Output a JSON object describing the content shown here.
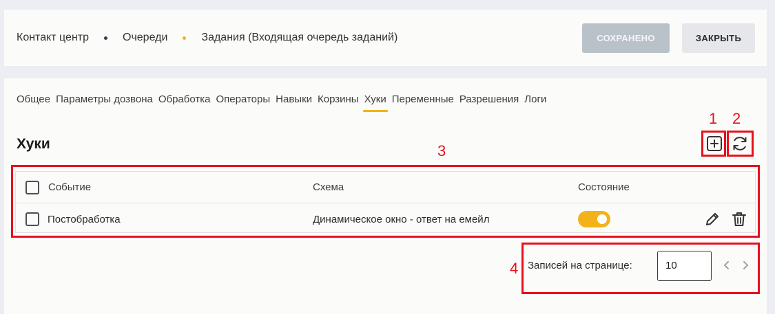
{
  "breadcrumb": {
    "items": [
      "Контакт центр",
      "Очереди",
      "Задания (Входящая очередь заданий)"
    ],
    "dot_colors": [
      "#2d3e50",
      "#f3b21a"
    ]
  },
  "toolbar": {
    "saved_label": "СОХРАНЕНО",
    "close_label": "ЗАКРЫТЬ"
  },
  "tabs": [
    {
      "label": "Общее"
    },
    {
      "label": "Параметры дозвона"
    },
    {
      "label": "Обработка"
    },
    {
      "label": "Операторы"
    },
    {
      "label": "Навыки"
    },
    {
      "label": "Корзины"
    },
    {
      "label": "Хуки",
      "active": true
    },
    {
      "label": "Переменные"
    },
    {
      "label": "Разрешения"
    },
    {
      "label": "Логи"
    }
  ],
  "section": {
    "title": "Хуки",
    "add_icon": "plus-square-icon",
    "refresh_icon": "refresh-icon"
  },
  "table": {
    "columns": [
      "Событие",
      "Схема",
      "Состояние"
    ],
    "rows": [
      {
        "event": "Постобработка",
        "scheme": "Динамическое окно - ответ на емейл",
        "enabled": true
      }
    ]
  },
  "pagination": {
    "label": "Записей на странице:",
    "per_page": "10"
  },
  "annotations": [
    "1",
    "2",
    "3",
    "4"
  ],
  "colors": {
    "accent": "#f3b21a",
    "annotation": "#e8101c"
  }
}
